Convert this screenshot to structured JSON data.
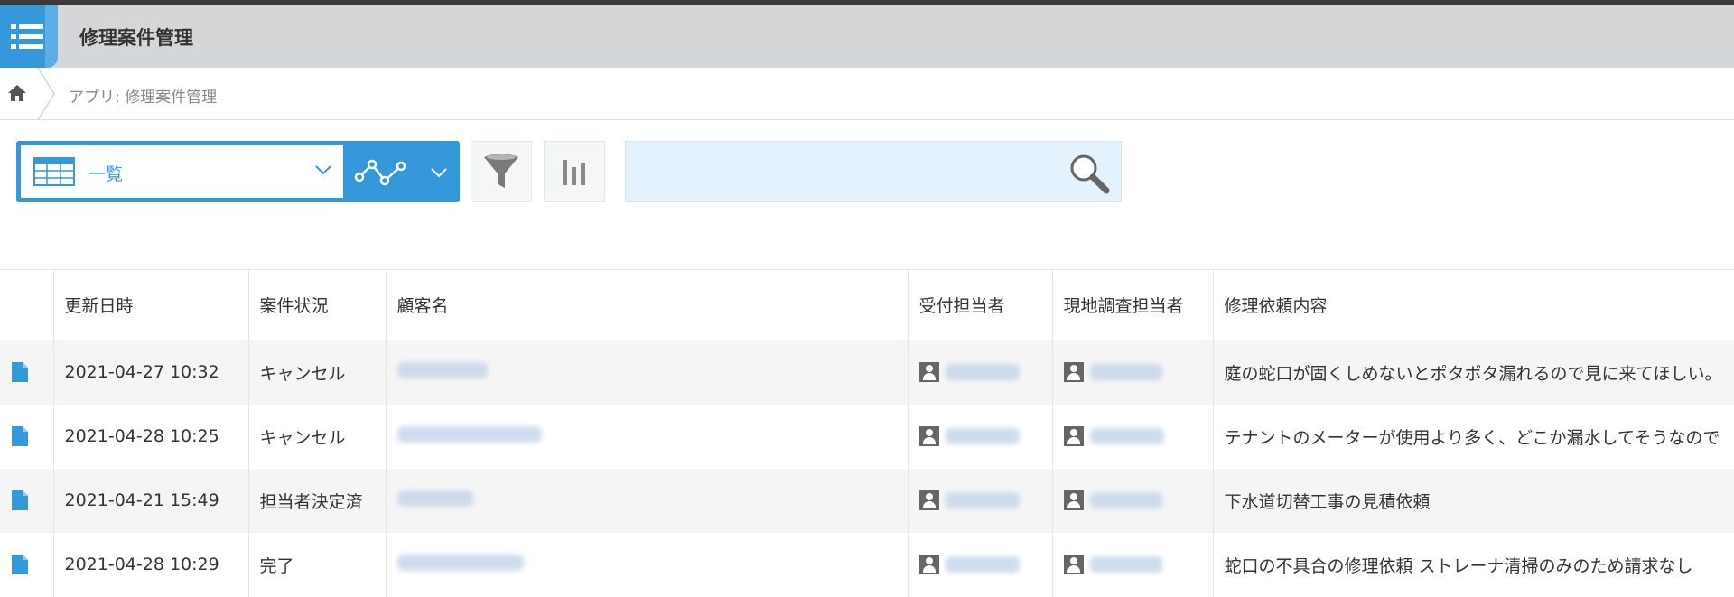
{
  "app": {
    "title": "修理案件管理"
  },
  "breadcrumb": {
    "app_label": "アプリ: 修理案件管理"
  },
  "view": {
    "selected": "一覧"
  },
  "search": {
    "placeholder": ""
  },
  "colors": {
    "accent": "#3498db",
    "header_bg": "#d4d6d7",
    "search_bg": "#e4f2fd"
  },
  "icons": [
    "menu-icon",
    "home-icon",
    "table-view-icon",
    "chevron-down-icon",
    "graph-icon",
    "filter-icon",
    "chart-icon",
    "search-icon",
    "document-icon",
    "user-icon"
  ],
  "table": {
    "columns": [
      "更新日時",
      "案件状況",
      "顧客名",
      "受付担当者",
      "現地調査担当者",
      "修理依頼内容"
    ],
    "rows": [
      {
        "updated": "2021-04-27 10:32",
        "status": "キャンセル",
        "request": "庭の蛇口が固くしめないとポタポタ漏れるので見に来てほしい。"
      },
      {
        "updated": "2021-04-28 10:25",
        "status": "キャンセル",
        "request": "テナントのメーターが使用より多く、どこか漏水してそうなので"
      },
      {
        "updated": "2021-04-21 15:49",
        "status": "担当者決定済",
        "request": "下水道切替工事の見積依頼"
      },
      {
        "updated": "2021-04-28 10:29",
        "status": "完了",
        "request": "蛇口の不具合の修理依頼 ストレーナ清掃のみのため請求なし"
      }
    ]
  }
}
